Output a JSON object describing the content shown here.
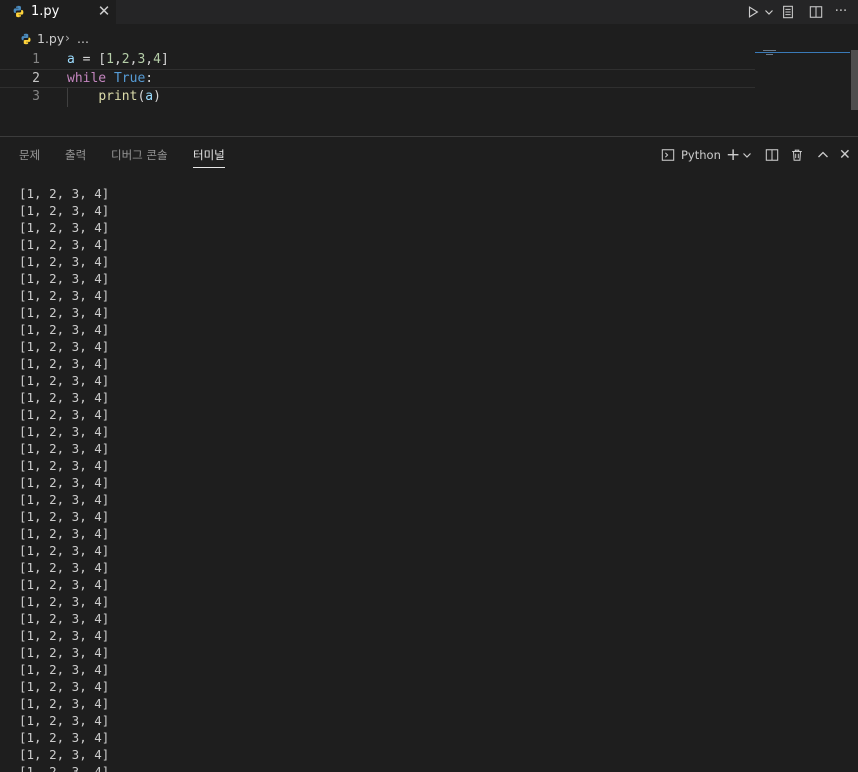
{
  "tab": {
    "filename": "1.py",
    "close_glyph": "✕"
  },
  "editor_actions": {
    "run_icon": "play-icon",
    "run_dropdown_icon": "chevron-down-icon",
    "open_changes_icon": "open-preview-icon",
    "split_icon": "split-editor-icon",
    "more_label": "···"
  },
  "breadcrumb": {
    "file": "1.py",
    "separator": "›",
    "more": "..."
  },
  "code": {
    "line_numbers": [
      "1",
      "2",
      "3"
    ],
    "current_line": 2,
    "lines": [
      [
        {
          "text": "a",
          "kind": "var"
        },
        {
          "text": " = [",
          "kind": "op"
        },
        {
          "text": "1",
          "kind": "num"
        },
        {
          "text": ",",
          "kind": "op"
        },
        {
          "text": "2",
          "kind": "num"
        },
        {
          "text": ",",
          "kind": "op"
        },
        {
          "text": "3",
          "kind": "num"
        },
        {
          "text": ",",
          "kind": "op"
        },
        {
          "text": "4",
          "kind": "num"
        },
        {
          "text": "]",
          "kind": "op"
        }
      ],
      [
        {
          "text": "while",
          "kind": "kw"
        },
        {
          "text": " ",
          "kind": "op"
        },
        {
          "text": "True",
          "kind": "const"
        },
        {
          "text": ":",
          "kind": "op"
        }
      ],
      [
        {
          "text": "    ",
          "kind": "op"
        },
        {
          "text": "print",
          "kind": "fn"
        },
        {
          "text": "(",
          "kind": "op"
        },
        {
          "text": "a",
          "kind": "var"
        },
        {
          "text": ")",
          "kind": "op"
        }
      ]
    ]
  },
  "panel": {
    "tabs": [
      {
        "label": "문제",
        "active": false
      },
      {
        "label": "출력",
        "active": false
      },
      {
        "label": "디버그 콘솔",
        "active": false
      },
      {
        "label": "터미널",
        "active": true
      }
    ],
    "terminal_name": "Python",
    "actions": {
      "terminal_icon": "terminal-icon",
      "add_label": "+",
      "add_dropdown_icon": "chevron-down-icon",
      "split_icon": "split-terminal-icon",
      "trash_icon": "trash-icon",
      "maximize_icon": "chevron-up-icon",
      "close_glyph": "✕"
    }
  },
  "terminal": {
    "output_line": "[1, 2, 3, 4]",
    "visible_line_count": 35
  },
  "colors": {
    "editor_bg": "#1e1e1e",
    "tabbar_bg": "#252526",
    "keyword": "#c586c0",
    "constant": "#569cd6",
    "function": "#dcdcaa",
    "number": "#b5cea8",
    "variable": "#9cdcfe"
  }
}
